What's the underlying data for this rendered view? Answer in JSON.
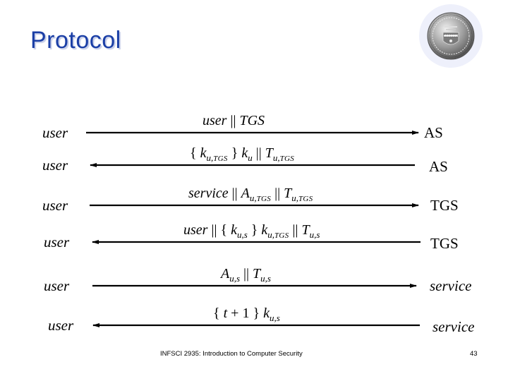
{
  "slide": {
    "title": "Protocol",
    "logo": "university-seal",
    "footer": {
      "course": "INFSCI 2935: Introduction to Computer Security",
      "page_number": "43"
    },
    "colors": {
      "title": "#1b3fa6",
      "line": "#000000"
    }
  },
  "messages": [
    {
      "from": "user",
      "to": "AS",
      "direction": "right",
      "parts": [
        [
          "i",
          "user"
        ],
        [
          "t",
          " || "
        ],
        [
          "i",
          "TGS"
        ]
      ]
    },
    {
      "from": "user",
      "to": "AS",
      "direction": "left",
      "parts": [
        [
          "t",
          "{ "
        ],
        [
          "i",
          "k"
        ],
        [
          "sub",
          "u,TGS"
        ],
        [
          "t",
          " } "
        ],
        [
          "i",
          "k"
        ],
        [
          "sub",
          "u"
        ],
        [
          "t",
          " || "
        ],
        [
          "i",
          "T"
        ],
        [
          "sub",
          "u,TGS"
        ]
      ]
    },
    {
      "from": "user",
      "to": "TGS",
      "direction": "right",
      "parts": [
        [
          "i",
          "service"
        ],
        [
          "t",
          " || "
        ],
        [
          "i",
          "A"
        ],
        [
          "sub",
          "u,TGS"
        ],
        [
          "t",
          " || "
        ],
        [
          "i",
          "T"
        ],
        [
          "sub",
          "u,TGS"
        ]
      ]
    },
    {
      "from": "user",
      "to": "TGS",
      "direction": "left",
      "parts": [
        [
          "i",
          "user"
        ],
        [
          "t",
          " || { "
        ],
        [
          "i",
          "k"
        ],
        [
          "sub",
          "u,s"
        ],
        [
          "t",
          " } "
        ],
        [
          "i",
          "k"
        ],
        [
          "sub",
          "u,TGS"
        ],
        [
          "t",
          " || "
        ],
        [
          "i",
          "T"
        ],
        [
          "sub",
          "u,s"
        ]
      ]
    },
    {
      "from": "user",
      "to": "service",
      "direction": "right",
      "parts": [
        [
          "i",
          "A"
        ],
        [
          "sub",
          "u,s"
        ],
        [
          "t",
          " || "
        ],
        [
          "i",
          "T"
        ],
        [
          "sub",
          "u,s"
        ]
      ]
    },
    {
      "from": "user",
      "to": "service",
      "direction": "left",
      "parts": [
        [
          "t",
          "{ "
        ],
        [
          "i",
          "t"
        ],
        [
          "t",
          " + 1 } "
        ],
        [
          "i",
          "k"
        ],
        [
          "sub",
          "u,s"
        ]
      ]
    }
  ]
}
